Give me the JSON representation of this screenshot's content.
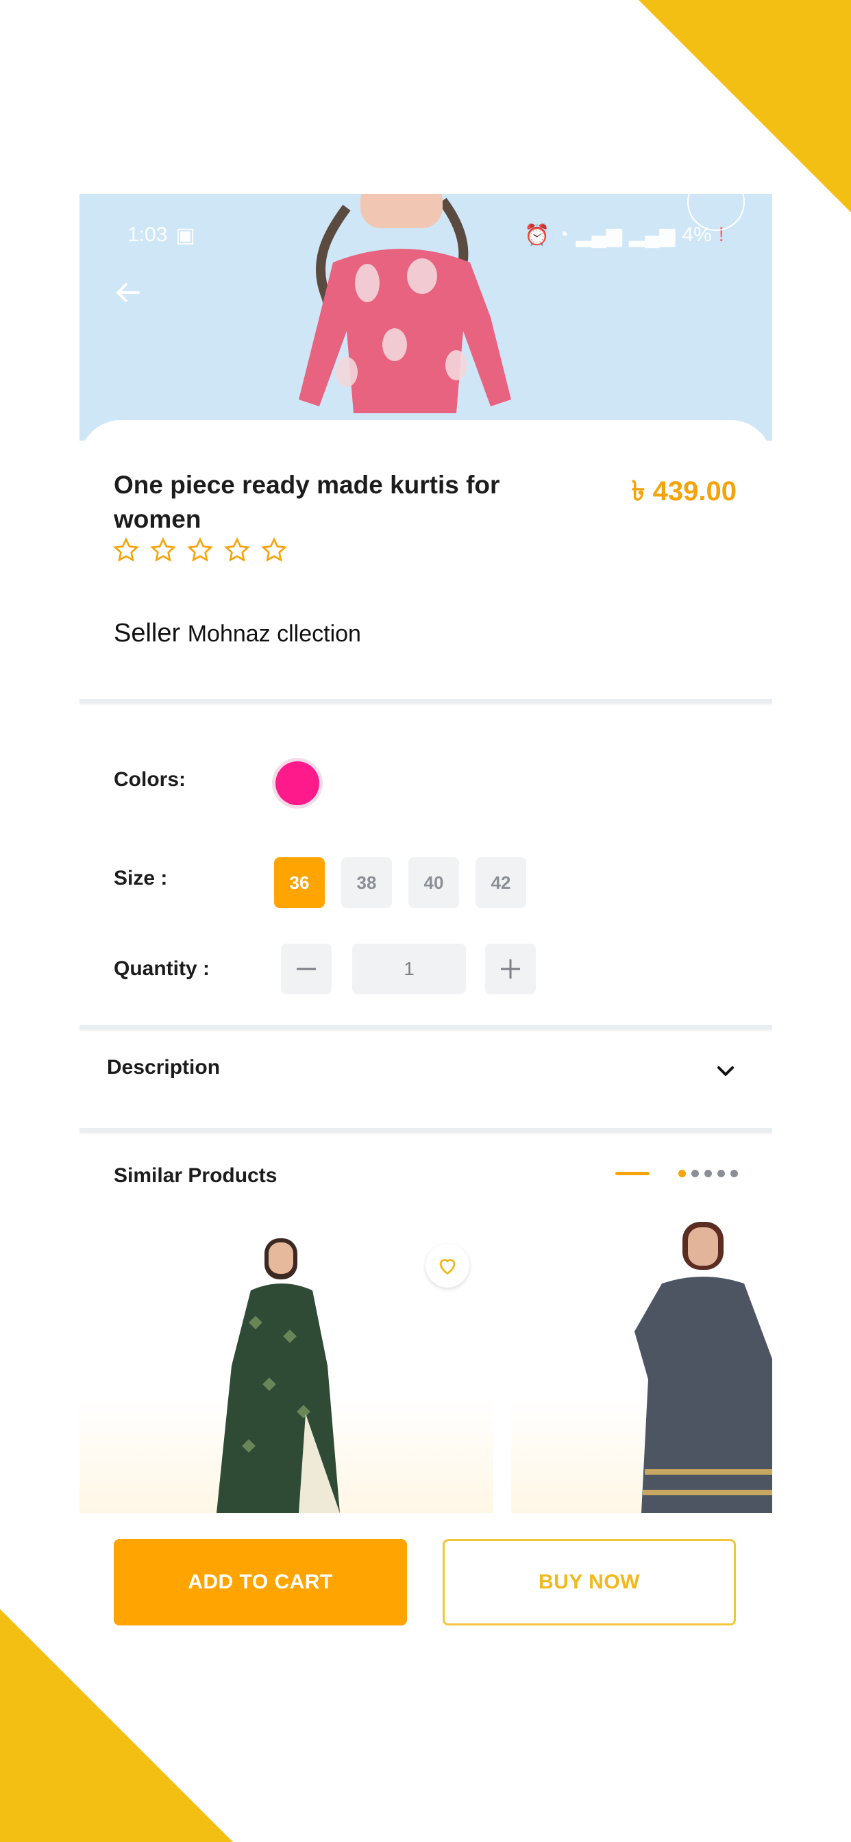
{
  "status_bar": {
    "time": "1:03",
    "battery": "4%",
    "battery_alert": "!"
  },
  "product": {
    "title": "One piece ready made kurtis for women",
    "price": "৳ 439.00",
    "rating": {
      "value": 0,
      "max": 5
    },
    "seller_label": "Seller",
    "seller_name": "Mohnaz cllection"
  },
  "options": {
    "colors_label": "Colors:",
    "colors": [
      "#ff1a8c"
    ],
    "size_label": "Size :",
    "sizes": [
      "36",
      "38",
      "40",
      "42"
    ],
    "selected_size": "36",
    "quantity_label": "Quantity :",
    "quantity": "1"
  },
  "description": {
    "label": "Description"
  },
  "similar": {
    "label": "Similar Products",
    "pager": {
      "pages": 5,
      "current": 1
    }
  },
  "actions": {
    "add_to_cart": "ADD TO CART",
    "buy_now": "BUY NOW"
  },
  "colors": {
    "accent": "#ffa400",
    "brand_yellow": "#f3bf12",
    "price": "#f5a30b"
  }
}
